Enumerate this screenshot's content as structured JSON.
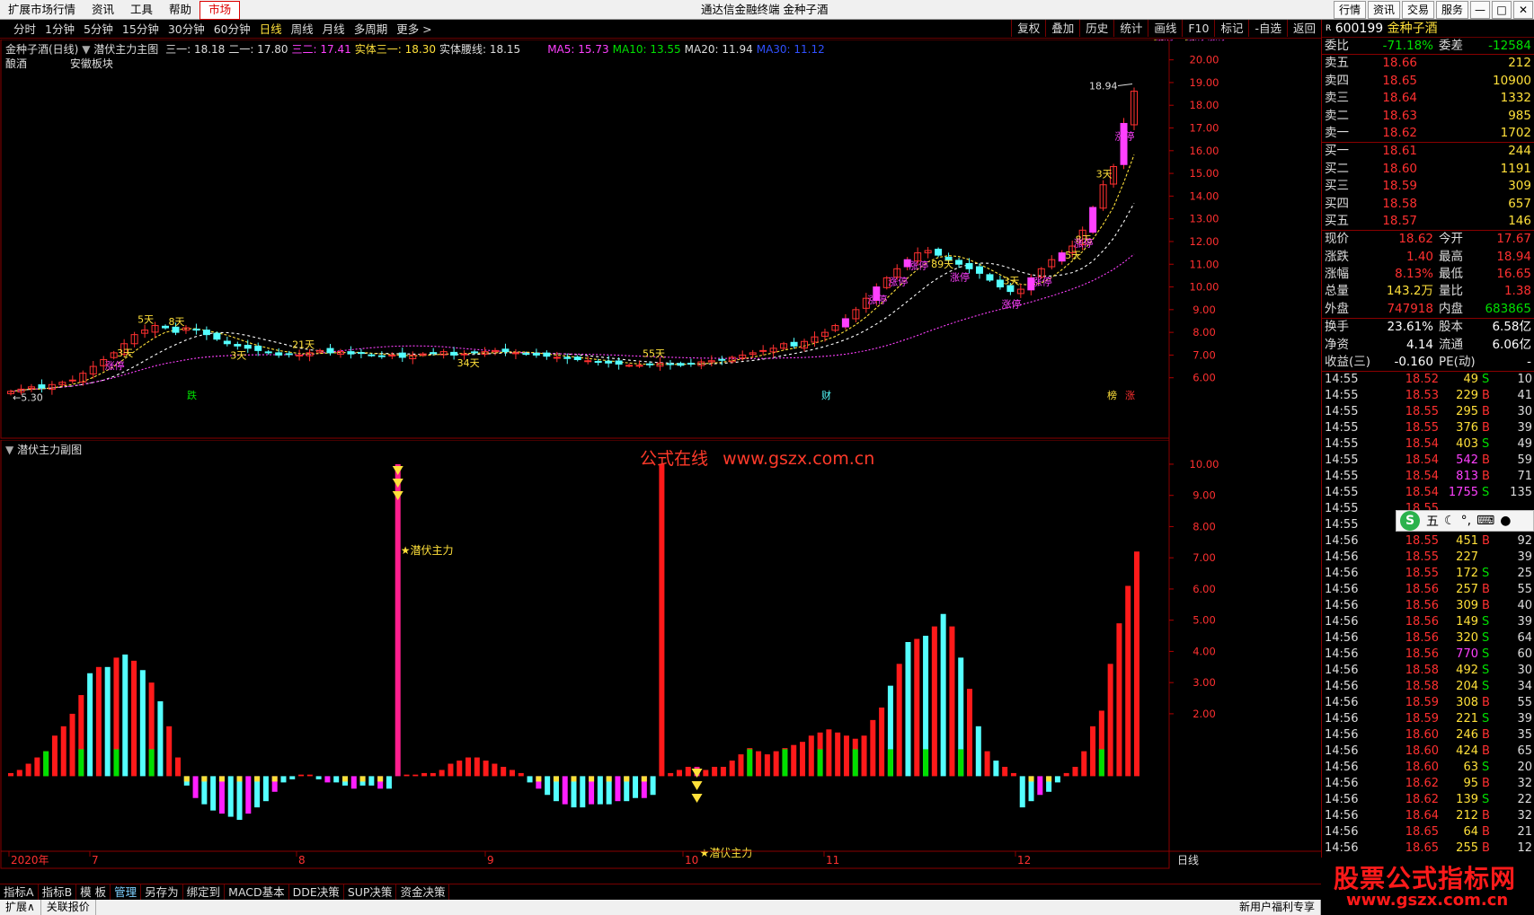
{
  "titlebar": {
    "menu": [
      "扩展市场行情",
      "资讯",
      "工具",
      "帮助",
      "市场"
    ],
    "window_title": "通达信金融终端  金种子酒",
    "right_buttons": [
      "行情",
      "资讯",
      "交易",
      "服务"
    ]
  },
  "toolbar": {
    "periods": [
      "分时",
      "1分钟",
      "5分钟",
      "15分钟",
      "30分钟",
      "60分钟",
      "日线",
      "周线",
      "月线",
      "多周期",
      "更多 >"
    ],
    "active_period": "日线",
    "actions": [
      "复权",
      "叠加",
      "历史",
      "统计",
      "画线",
      "F10",
      "标记",
      "-自选",
      "返回"
    ]
  },
  "main_legend": {
    "stock": "金种子酒(日线)",
    "indicator": "潜伏主力主图",
    "items": [
      {
        "label": "三一: 18.18",
        "color": "#dddddd"
      },
      {
        "label": "二一: 17.80",
        "color": "#dddddd"
      },
      {
        "label": "三二: 17.41",
        "color": "#ff40ff"
      },
      {
        "label": "实体三一: 18.30",
        "color": "#ffe03a"
      },
      {
        "label": "实体腰线: 18.15",
        "color": "#dddddd"
      },
      {
        "label": "MA5: 15.73",
        "color": "#ff40ff"
      },
      {
        "label": "MA10: 13.55",
        "color": "#00e000"
      },
      {
        "label": "MA20: 11.94",
        "color": "#dddddd"
      },
      {
        "label": "MA30: 11.12",
        "color": "#3050ff"
      }
    ],
    "industry": "酿酒",
    "region": "安徽板块"
  },
  "main_axis": [
    "20.00",
    "19.00",
    "18.00",
    "17.00",
    "16.00",
    "15.00",
    "14.00",
    "13.00",
    "12.00",
    "11.00",
    "10.00",
    "9.00",
    "8.00",
    "7.00",
    "6.00"
  ],
  "main_labels": {
    "high_mark": "18.94",
    "low_mark": "5.30",
    "days": [
      "5天",
      "3天",
      "8天",
      "3天",
      "21天",
      "34天",
      "55天",
      "89天",
      "3天",
      "5天",
      "3天",
      "8天",
      "3天",
      "5天"
    ],
    "limit": "涨停",
    "event_tags": [
      "跌",
      "财",
      "榜",
      "涨"
    ]
  },
  "sub_legend": {
    "indicator": "潜伏主力副图",
    "site_name": "公式在线",
    "site_url": "www.gszx.com.cn",
    "signal_label": "★潜伏主力"
  },
  "sub_axis": [
    "10.00",
    "9.00",
    "8.00",
    "7.00",
    "6.00",
    "5.00",
    "4.00",
    "3.00",
    "2.00"
  ],
  "date_axis": [
    "2020年",
    "7",
    "8",
    "9",
    "10",
    "11",
    "12"
  ],
  "date_axis_right": "日线",
  "bottom_tabs": [
    "指标A",
    "指标B",
    "模 板",
    "管理",
    "另存为",
    "绑定到",
    "MACD基本",
    "DDE决策",
    "SUP决策",
    "资金决策"
  ],
  "selected_tab": "管理",
  "status": {
    "left": [
      "扩展∧",
      "关联报价"
    ],
    "right": "新用户福利专享"
  },
  "quote": {
    "code": "600199",
    "name": "金种子酒",
    "weibi": {
      "label": "委比",
      "value": "-71.18%",
      "label2": "委差",
      "value2": "-12584"
    },
    "asks": [
      {
        "label": "卖五",
        "price": "18.66",
        "vol": "212"
      },
      {
        "label": "卖四",
        "price": "18.65",
        "vol": "10900"
      },
      {
        "label": "卖三",
        "price": "18.64",
        "vol": "1332"
      },
      {
        "label": "卖二",
        "price": "18.63",
        "vol": "985"
      },
      {
        "label": "卖一",
        "price": "18.62",
        "vol": "1702"
      }
    ],
    "bids": [
      {
        "label": "买一",
        "price": "18.61",
        "vol": "244"
      },
      {
        "label": "买二",
        "price": "18.60",
        "vol": "1191"
      },
      {
        "label": "买三",
        "price": "18.59",
        "vol": "309"
      },
      {
        "label": "买四",
        "price": "18.58",
        "vol": "657"
      },
      {
        "label": "买五",
        "price": "18.57",
        "vol": "146"
      }
    ],
    "stats": [
      {
        "l": "现价",
        "v": "18.62",
        "vc": "red",
        "l2": "今开",
        "v2": "17.67",
        "v2c": "red"
      },
      {
        "l": "涨跌",
        "v": "1.40",
        "vc": "red",
        "l2": "最高",
        "v2": "18.94",
        "v2c": "red"
      },
      {
        "l": "涨幅",
        "v": "8.13%",
        "vc": "red",
        "l2": "最低",
        "v2": "16.65",
        "v2c": "red"
      },
      {
        "l": "总量",
        "v": "143.2万",
        "vc": "yellow",
        "l2": "量比",
        "v2": "1.38",
        "v2c": "red"
      },
      {
        "l": "外盘",
        "v": "747918",
        "vc": "red",
        "l2": "内盘",
        "v2": "683865",
        "v2c": "green"
      }
    ],
    "stats2": [
      {
        "l": "换手",
        "v": "23.61%",
        "vc": "white",
        "l2": "股本",
        "v2": "6.58亿",
        "v2c": "white"
      },
      {
        "l": "净资",
        "v": "4.14",
        "vc": "white",
        "l2": "流通",
        "v2": "6.06亿",
        "v2c": "white"
      },
      {
        "l": "收益(三)",
        "v": "-0.160",
        "vc": "white",
        "l2": "PE(动)",
        "v2": "-",
        "v2c": "white"
      }
    ],
    "ticks": [
      {
        "t": "14:55",
        "p": "18.52",
        "v": "49",
        "bs": "S",
        "n": "10"
      },
      {
        "t": "14:55",
        "p": "18.53",
        "v": "229",
        "bs": "B",
        "n": "41"
      },
      {
        "t": "14:55",
        "p": "18.55",
        "v": "295",
        "bs": "B",
        "n": "30"
      },
      {
        "t": "14:55",
        "p": "18.55",
        "v": "376",
        "bs": "B",
        "n": "39"
      },
      {
        "t": "14:55",
        "p": "18.54",
        "v": "403",
        "bs": "S",
        "n": "49"
      },
      {
        "t": "14:55",
        "p": "18.54",
        "v": "542",
        "bs": "B",
        "n": "59"
      },
      {
        "t": "14:55",
        "p": "18.54",
        "v": "813",
        "bs": "B",
        "n": "71"
      },
      {
        "t": "14:55",
        "p": "18.54",
        "v": "1755",
        "bs": "S",
        "n": "135"
      },
      {
        "t": "14:55",
        "p": "18.55",
        "v": "",
        "bs": "",
        "n": ""
      },
      {
        "t": "14:55",
        "p": "18.55",
        "v": "591",
        "bs": "B",
        "n": "52"
      },
      {
        "t": "14:56",
        "p": "18.55",
        "v": "451",
        "bs": "B",
        "n": "92"
      },
      {
        "t": "14:56",
        "p": "18.55",
        "v": "227",
        "bs": "",
        "n": "39"
      },
      {
        "t": "14:56",
        "p": "18.55",
        "v": "172",
        "bs": "S",
        "n": "25"
      },
      {
        "t": "14:56",
        "p": "18.56",
        "v": "257",
        "bs": "B",
        "n": "55"
      },
      {
        "t": "14:56",
        "p": "18.56",
        "v": "309",
        "bs": "B",
        "n": "40"
      },
      {
        "t": "14:56",
        "p": "18.56",
        "v": "149",
        "bs": "S",
        "n": "39"
      },
      {
        "t": "14:56",
        "p": "18.56",
        "v": "320",
        "bs": "S",
        "n": "64"
      },
      {
        "t": "14:56",
        "p": "18.56",
        "v": "770",
        "bs": "S",
        "n": "60"
      },
      {
        "t": "14:56",
        "p": "18.58",
        "v": "492",
        "bs": "S",
        "n": "30"
      },
      {
        "t": "14:56",
        "p": "18.58",
        "v": "204",
        "bs": "S",
        "n": "34"
      },
      {
        "t": "14:56",
        "p": "18.59",
        "v": "308",
        "bs": "B",
        "n": "55"
      },
      {
        "t": "14:56",
        "p": "18.59",
        "v": "221",
        "bs": "S",
        "n": "39"
      },
      {
        "t": "14:56",
        "p": "18.60",
        "v": "246",
        "bs": "B",
        "n": "35"
      },
      {
        "t": "14:56",
        "p": "18.60",
        "v": "424",
        "bs": "B",
        "n": "65"
      },
      {
        "t": "14:56",
        "p": "18.60",
        "v": "63",
        "bs": "S",
        "n": "20"
      },
      {
        "t": "14:56",
        "p": "18.62",
        "v": "95",
        "bs": "B",
        "n": "32"
      },
      {
        "t": "14:56",
        "p": "18.62",
        "v": "139",
        "bs": "S",
        "n": "22"
      },
      {
        "t": "14:56",
        "p": "18.64",
        "v": "212",
        "bs": "B",
        "n": "32"
      },
      {
        "t": "14:56",
        "p": "18.65",
        "v": "64",
        "bs": "B",
        "n": "21"
      },
      {
        "t": "14:56",
        "p": "18.65",
        "v": "255",
        "bs": "B",
        "n": "12"
      }
    ]
  },
  "ime": {
    "logo": "S",
    "mode": "五",
    "icons": [
      "moon-icon",
      "punct-icon",
      "keyboard-icon",
      "user-icon"
    ]
  },
  "watermark": {
    "title": "股票公式指标网",
    "url": "www.gszx.com.cn"
  },
  "chart_data": [
    {
      "type": "candlestick",
      "title": "金种子酒(日线)",
      "ylim": [
        5,
        20.5
      ],
      "y_ticks": [
        6,
        7,
        8,
        9,
        10,
        11,
        12,
        13,
        14,
        15,
        16,
        17,
        18,
        19,
        20
      ],
      "annotations": {
        "max": 18.94,
        "min": 5.3
      },
      "close": [
        5.4,
        5.5,
        5.6,
        5.55,
        5.7,
        5.8,
        5.9,
        6.2,
        6.5,
        6.8,
        7.1,
        7.5,
        7.9,
        8.1,
        8.3,
        8.2,
        8.0,
        8.2,
        8.1,
        7.9,
        7.7,
        7.5,
        7.4,
        7.3,
        7.2,
        7.1,
        7.0,
        7.05,
        7.0,
        7.1,
        7.2,
        7.1,
        7.15,
        7.05,
        7.1,
        7.0,
        6.95,
        7.0,
        6.9,
        7.0,
        7.05,
        7.1,
        7.15,
        7.0,
        7.05,
        7.1,
        7.15,
        7.2,
        7.15,
        7.1,
        7.05,
        7.0,
        6.95,
        6.9,
        6.85,
        6.8,
        6.75,
        6.7,
        6.65,
        6.6,
        6.55,
        6.55,
        6.6,
        6.65,
        6.6,
        6.55,
        6.6,
        6.7,
        6.75,
        6.8,
        6.9,
        7.0,
        7.1,
        7.2,
        7.3,
        7.5,
        7.4,
        7.6,
        7.8,
        8.0,
        8.3,
        8.6,
        9.0,
        9.5,
        10.0,
        10.4,
        10.8,
        11.2,
        11.5,
        11.6,
        11.4,
        11.2,
        11.0,
        10.8,
        10.6,
        10.3,
        10.0,
        9.8,
        9.9,
        10.4,
        10.8,
        11.2,
        11.5,
        11.8,
        12.5,
        13.5,
        14.5,
        15.3,
        17.2,
        18.62
      ],
      "ma_lines": [
        "MA5",
        "MA10",
        "MA20",
        "MA30"
      ]
    },
    {
      "type": "bar",
      "title": "潜伏主力副图",
      "ylim": [
        -1.6,
        10.2
      ],
      "y_ticks": [
        2,
        3,
        4,
        5,
        6,
        7,
        8,
        9,
        10
      ],
      "values": [
        0.1,
        0.2,
        0.4,
        0.6,
        0.8,
        1.3,
        1.6,
        2.0,
        2.6,
        3.3,
        3.5,
        3.5,
        3.8,
        3.9,
        3.7,
        3.4,
        3.0,
        2.4,
        1.6,
        0.6,
        -0.3,
        -0.7,
        -0.9,
        -1.1,
        -1.2,
        -1.3,
        -1.4,
        -1.2,
        -1.0,
        -0.8,
        -0.5,
        -0.2,
        -0.1,
        0.05,
        0.05,
        -0.1,
        -0.2,
        -0.2,
        -0.3,
        -0.4,
        -0.3,
        -0.3,
        -0.4,
        -0.4,
        10.0,
        0.05,
        0.05,
        0.1,
        0.1,
        0.2,
        0.4,
        0.5,
        0.6,
        0.6,
        0.5,
        0.4,
        0.3,
        0.2,
        0.1,
        -0.2,
        -0.4,
        -0.6,
        -0.8,
        -0.9,
        -1.0,
        -1.0,
        -0.9,
        -0.9,
        -0.9,
        -0.8,
        -0.8,
        -0.7,
        -0.7,
        -0.6,
        10.0,
        0.1,
        0.2,
        0.3,
        0.3,
        0.2,
        0.3,
        0.3,
        0.5,
        0.7,
        0.9,
        0.8,
        0.7,
        0.8,
        0.9,
        1.0,
        1.1,
        1.3,
        1.4,
        1.5,
        1.4,
        1.3,
        1.2,
        1.3,
        1.8,
        2.2,
        2.9,
        3.6,
        4.3,
        4.4,
        4.5,
        4.8,
        5.2,
        4.8,
        3.8,
        2.8,
        1.6,
        0.8,
        0.5,
        0.3,
        0.1,
        -1.0,
        -0.8,
        -0.6,
        -0.5,
        -0.2,
        0.1,
        0.3,
        0.8,
        1.6,
        2.1,
        3.6,
        4.9,
        6.1,
        7.2
      ],
      "signals": [
        {
          "x": 44,
          "label": "★潜伏主力"
        },
        {
          "x": 78,
          "label": "★潜伏主力"
        }
      ]
    }
  ]
}
